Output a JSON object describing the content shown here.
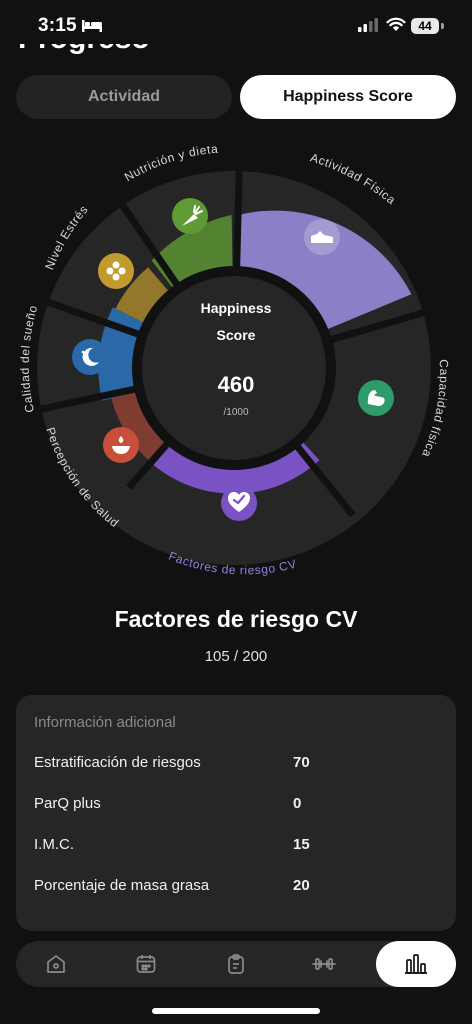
{
  "status": {
    "time": "3:15",
    "battery": "44"
  },
  "page": {
    "title": "Progreso"
  },
  "tabs": [
    {
      "label": "Actividad",
      "active": false
    },
    {
      "label": "Happiness Score",
      "active": true
    }
  ],
  "wheel": {
    "center_line1": "Happiness",
    "center_line2": "Score",
    "score": "460",
    "max": "/1000",
    "segments": [
      {
        "label": "Actividad Física",
        "icon": "sneaker-icon",
        "color": "#8b7fc7"
      },
      {
        "label": "Capacidad física",
        "icon": "muscle-icon",
        "color": "#2f9a6a"
      },
      {
        "label": "Factores de riesgo CV",
        "icon": "heart-check-icon",
        "color": "#7a52c4"
      },
      {
        "label": "Percepción de Salud",
        "icon": "candle-icon",
        "color": "#c8503a"
      },
      {
        "label": "Calidad del sueño",
        "icon": "moon-icon",
        "color": "#2b68a8"
      },
      {
        "label": "Nivel Estrés",
        "icon": "flower-icon",
        "color": "#c29a2e"
      },
      {
        "label": "Nutrición y dieta",
        "icon": "carrot-icon",
        "color": "#5f9a34"
      }
    ]
  },
  "detail": {
    "title": "Factores de riesgo CV",
    "score": "105 / 200"
  },
  "info": {
    "header": "Información adicional",
    "rows": [
      {
        "label": "Estratificación de riesgos",
        "value": "70"
      },
      {
        "label": "ParQ plus",
        "value": "0"
      },
      {
        "label": "I.M.C.",
        "value": "15"
      },
      {
        "label": "Porcentaje de masa grasa",
        "value": "20"
      }
    ]
  },
  "nav": {
    "items": [
      "home-icon",
      "calendar-icon",
      "clipboard-icon",
      "dumbbell-icon",
      "bar-chart-icon"
    ],
    "active": "bar-chart-icon"
  }
}
